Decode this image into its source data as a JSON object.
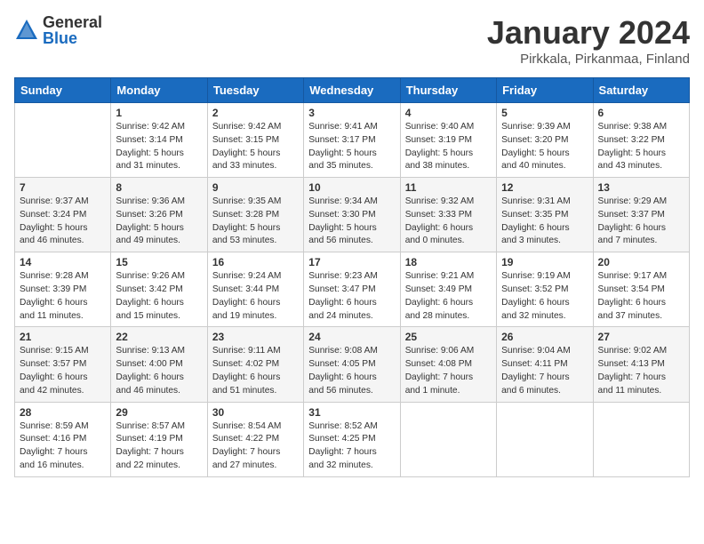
{
  "header": {
    "logo_general": "General",
    "logo_blue": "Blue",
    "title": "January 2024",
    "subtitle": "Pirkkala, Pirkanmaa, Finland"
  },
  "days_of_week": [
    "Sunday",
    "Monday",
    "Tuesday",
    "Wednesday",
    "Thursday",
    "Friday",
    "Saturday"
  ],
  "weeks": [
    [
      {
        "day": "",
        "info": ""
      },
      {
        "day": "1",
        "info": "Sunrise: 9:42 AM\nSunset: 3:14 PM\nDaylight: 5 hours\nand 31 minutes."
      },
      {
        "day": "2",
        "info": "Sunrise: 9:42 AM\nSunset: 3:15 PM\nDaylight: 5 hours\nand 33 minutes."
      },
      {
        "day": "3",
        "info": "Sunrise: 9:41 AM\nSunset: 3:17 PM\nDaylight: 5 hours\nand 35 minutes."
      },
      {
        "day": "4",
        "info": "Sunrise: 9:40 AM\nSunset: 3:19 PM\nDaylight: 5 hours\nand 38 minutes."
      },
      {
        "day": "5",
        "info": "Sunrise: 9:39 AM\nSunset: 3:20 PM\nDaylight: 5 hours\nand 40 minutes."
      },
      {
        "day": "6",
        "info": "Sunrise: 9:38 AM\nSunset: 3:22 PM\nDaylight: 5 hours\nand 43 minutes."
      }
    ],
    [
      {
        "day": "7",
        "info": "Sunrise: 9:37 AM\nSunset: 3:24 PM\nDaylight: 5 hours\nand 46 minutes."
      },
      {
        "day": "8",
        "info": "Sunrise: 9:36 AM\nSunset: 3:26 PM\nDaylight: 5 hours\nand 49 minutes."
      },
      {
        "day": "9",
        "info": "Sunrise: 9:35 AM\nSunset: 3:28 PM\nDaylight: 5 hours\nand 53 minutes."
      },
      {
        "day": "10",
        "info": "Sunrise: 9:34 AM\nSunset: 3:30 PM\nDaylight: 5 hours\nand 56 minutes."
      },
      {
        "day": "11",
        "info": "Sunrise: 9:32 AM\nSunset: 3:33 PM\nDaylight: 6 hours\nand 0 minutes."
      },
      {
        "day": "12",
        "info": "Sunrise: 9:31 AM\nSunset: 3:35 PM\nDaylight: 6 hours\nand 3 minutes."
      },
      {
        "day": "13",
        "info": "Sunrise: 9:29 AM\nSunset: 3:37 PM\nDaylight: 6 hours\nand 7 minutes."
      }
    ],
    [
      {
        "day": "14",
        "info": "Sunrise: 9:28 AM\nSunset: 3:39 PM\nDaylight: 6 hours\nand 11 minutes."
      },
      {
        "day": "15",
        "info": "Sunrise: 9:26 AM\nSunset: 3:42 PM\nDaylight: 6 hours\nand 15 minutes."
      },
      {
        "day": "16",
        "info": "Sunrise: 9:24 AM\nSunset: 3:44 PM\nDaylight: 6 hours\nand 19 minutes."
      },
      {
        "day": "17",
        "info": "Sunrise: 9:23 AM\nSunset: 3:47 PM\nDaylight: 6 hours\nand 24 minutes."
      },
      {
        "day": "18",
        "info": "Sunrise: 9:21 AM\nSunset: 3:49 PM\nDaylight: 6 hours\nand 28 minutes."
      },
      {
        "day": "19",
        "info": "Sunrise: 9:19 AM\nSunset: 3:52 PM\nDaylight: 6 hours\nand 32 minutes."
      },
      {
        "day": "20",
        "info": "Sunrise: 9:17 AM\nSunset: 3:54 PM\nDaylight: 6 hours\nand 37 minutes."
      }
    ],
    [
      {
        "day": "21",
        "info": "Sunrise: 9:15 AM\nSunset: 3:57 PM\nDaylight: 6 hours\nand 42 minutes."
      },
      {
        "day": "22",
        "info": "Sunrise: 9:13 AM\nSunset: 4:00 PM\nDaylight: 6 hours\nand 46 minutes."
      },
      {
        "day": "23",
        "info": "Sunrise: 9:11 AM\nSunset: 4:02 PM\nDaylight: 6 hours\nand 51 minutes."
      },
      {
        "day": "24",
        "info": "Sunrise: 9:08 AM\nSunset: 4:05 PM\nDaylight: 6 hours\nand 56 minutes."
      },
      {
        "day": "25",
        "info": "Sunrise: 9:06 AM\nSunset: 4:08 PM\nDaylight: 7 hours\nand 1 minute."
      },
      {
        "day": "26",
        "info": "Sunrise: 9:04 AM\nSunset: 4:11 PM\nDaylight: 7 hours\nand 6 minutes."
      },
      {
        "day": "27",
        "info": "Sunrise: 9:02 AM\nSunset: 4:13 PM\nDaylight: 7 hours\nand 11 minutes."
      }
    ],
    [
      {
        "day": "28",
        "info": "Sunrise: 8:59 AM\nSunset: 4:16 PM\nDaylight: 7 hours\nand 16 minutes."
      },
      {
        "day": "29",
        "info": "Sunrise: 8:57 AM\nSunset: 4:19 PM\nDaylight: 7 hours\nand 22 minutes."
      },
      {
        "day": "30",
        "info": "Sunrise: 8:54 AM\nSunset: 4:22 PM\nDaylight: 7 hours\nand 27 minutes."
      },
      {
        "day": "31",
        "info": "Sunrise: 8:52 AM\nSunset: 4:25 PM\nDaylight: 7 hours\nand 32 minutes."
      },
      {
        "day": "",
        "info": ""
      },
      {
        "day": "",
        "info": ""
      },
      {
        "day": "",
        "info": ""
      }
    ]
  ]
}
